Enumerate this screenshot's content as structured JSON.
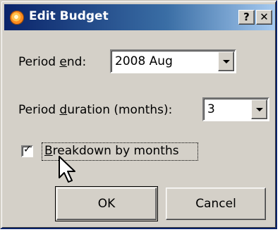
{
  "dialog": {
    "title": "Edit Budget",
    "help_glyph": "?",
    "close_glyph": "✕"
  },
  "period_end": {
    "label_before": "Period ",
    "label_accel": "e",
    "label_after": "nd:",
    "value": "2008 Aug"
  },
  "period_duration": {
    "label_before": "Period ",
    "label_accel": "d",
    "label_after": "uration (months):",
    "value": "3"
  },
  "breakdown": {
    "checked": true,
    "check_glyph": "✓",
    "label_accel": "B",
    "label_after": "reakdown by months"
  },
  "buttons": {
    "ok": "OK",
    "cancel": "Cancel"
  },
  "icons": {
    "app": "budget-app-icon",
    "cursor": "mouse-pointer-icon"
  }
}
